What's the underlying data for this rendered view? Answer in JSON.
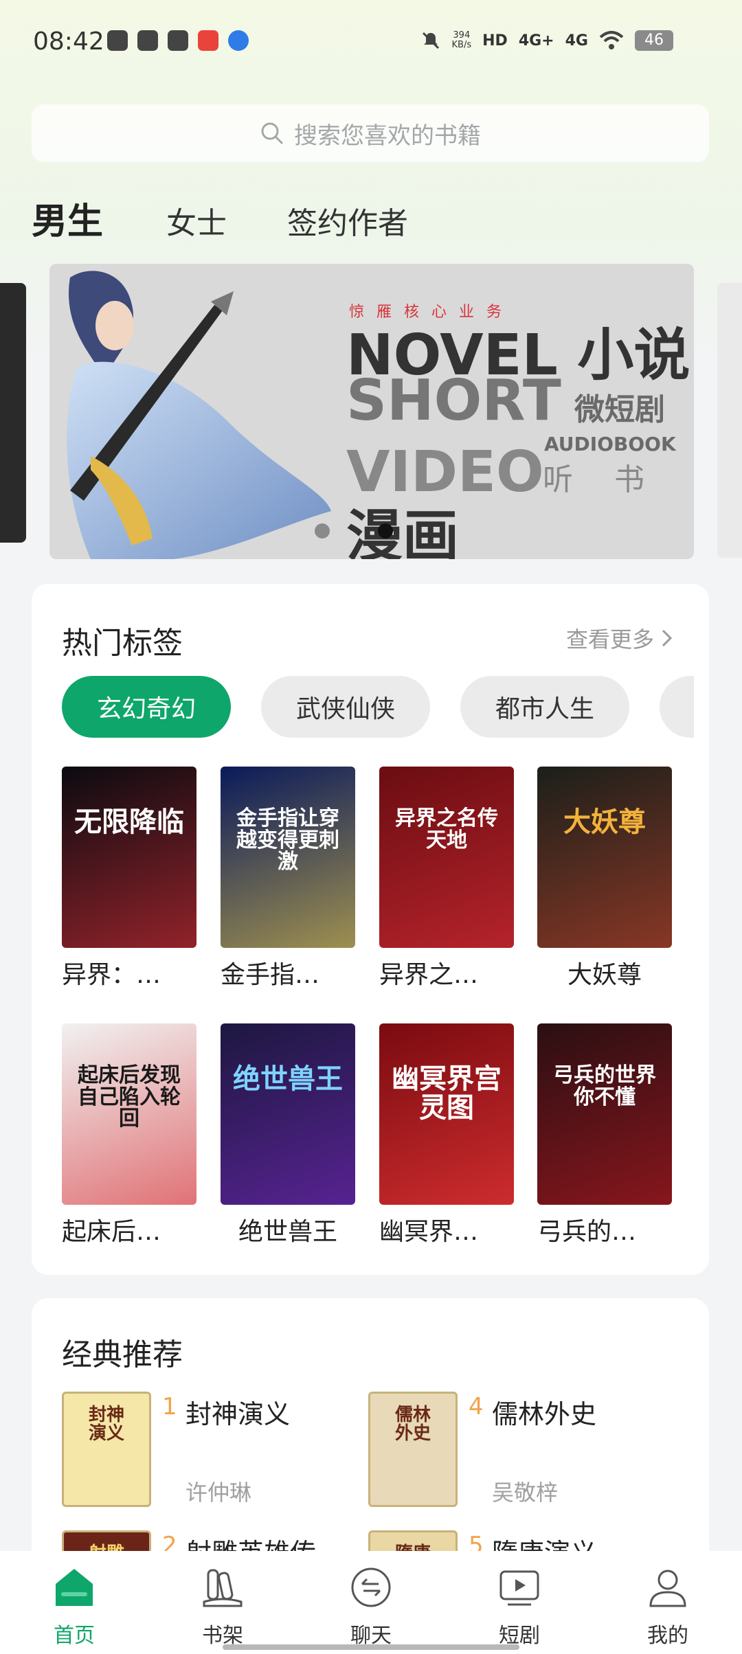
{
  "status_bar": {
    "time": "08:42",
    "speed_value": "394",
    "speed_unit": "KB/s",
    "hd": "HD",
    "sig1": "4G+",
    "sig2": "4G",
    "battery": "46"
  },
  "search": {
    "placeholder": "搜索您喜欢的书籍"
  },
  "tabs": [
    {
      "label": "男生",
      "active": true
    },
    {
      "label": "女士",
      "active": false
    },
    {
      "label": "签约作者",
      "active": false
    }
  ],
  "banner": {
    "subtitle": "惊雁核心业务",
    "line1": "NOVEL 小说",
    "line2": "SHORT",
    "line3": "VIDEO",
    "line4": "漫画COMICS",
    "small1": "微短剧",
    "small2": "AUDIOBOOK",
    "small3": "听书"
  },
  "hot_tags": {
    "title": "热门标签",
    "more": "查看更多",
    "tags": [
      "玄幻奇幻",
      "武侠仙侠",
      "都市人生"
    ],
    "books": [
      {
        "title": "异界：…",
        "cover_text": "无限降临",
        "bg": "#0b0b10",
        "fg": "#ffffff",
        "accent": "#e3303a"
      },
      {
        "title": "金手指…",
        "cover_text": "金手指让穿越变得更刺激",
        "bg": "#0a1a5a",
        "fg": "#ffffff",
        "accent": "#f7d64a"
      },
      {
        "title": "异界之…",
        "cover_text": "异界之名传天地",
        "bg": "#6a0d12",
        "fg": "#ffffff",
        "accent": "#e3303a"
      },
      {
        "title": "大妖尊",
        "cover_text": "大妖尊",
        "bg": "#1b1f1a",
        "fg": "#f2b23c",
        "accent": "#c9452c"
      },
      {
        "title": "起床后…",
        "cover_text": "起床后发现自己陷入轮回",
        "bg": "#f1f1f1",
        "fg": "#1a1a1a",
        "accent": "#d6262c"
      },
      {
        "title": "绝世兽王",
        "cover_text": "绝世兽王",
        "bg": "#1d1740",
        "fg": "#7fd3ff",
        "accent": "#7a2ac2"
      },
      {
        "title": "幽冥界…",
        "cover_text": "幽冥界宫灵图",
        "bg": "#7a0b10",
        "fg": "#ffffff",
        "accent": "#ff4040"
      },
      {
        "title": "弓兵的…",
        "cover_text": "弓兵的世界你不懂",
        "bg": "#2a0f12",
        "fg": "#ffffff",
        "accent": "#c01a24"
      }
    ]
  },
  "classic": {
    "title": "经典推荐",
    "items": [
      {
        "rank": "1",
        "name": "封神演义",
        "author": "许仲琳",
        "cover_text": "封神演义",
        "bg": "#f4e7a8"
      },
      {
        "rank": "4",
        "name": "儒林外史",
        "author": "吴敬梓",
        "cover_text": "儒林外史",
        "bg": "#e8d9b8"
      },
      {
        "rank": "2",
        "name": "射雕英雄传",
        "author": "",
        "cover_text": "射雕英雄传",
        "bg": "#6b2418"
      },
      {
        "rank": "5",
        "name": "隋唐演义",
        "author": "",
        "cover_text": "隋唐演义",
        "bg": "#e9d7a4"
      }
    ]
  },
  "bottom_nav": [
    {
      "label": "首页",
      "icon": "home-icon",
      "active": true
    },
    {
      "label": "书架",
      "icon": "bookshelf-icon",
      "active": false
    },
    {
      "label": "聊天",
      "icon": "chat-icon",
      "active": false
    },
    {
      "label": "短剧",
      "icon": "video-icon",
      "active": false
    },
    {
      "label": "我的",
      "icon": "profile-icon",
      "active": false
    }
  ],
  "colors": {
    "accent": "#0ea66a",
    "rank": "#f3a24a"
  }
}
